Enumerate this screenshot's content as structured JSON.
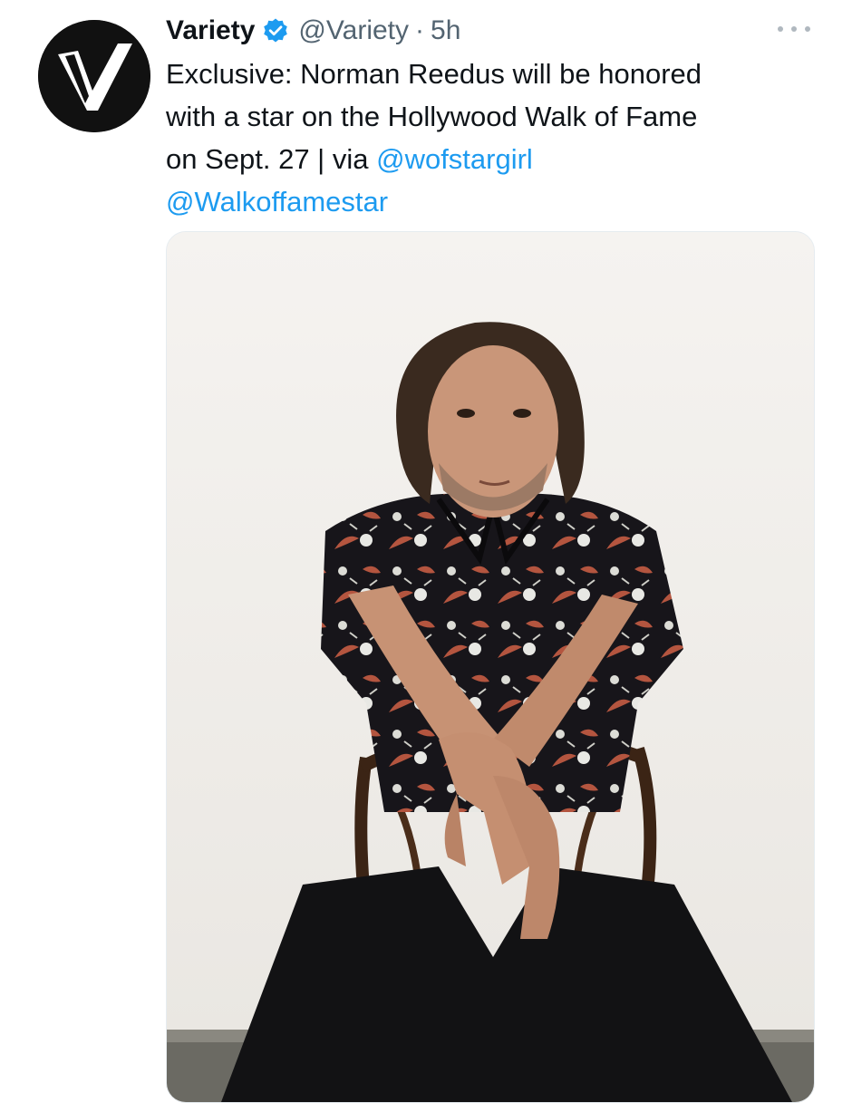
{
  "tweet": {
    "display_name": "Variety",
    "handle": "@Variety",
    "separator": "·",
    "time": "5h",
    "text_line1": "Exclusive: Norman Reedus will be honored",
    "text_line2": "with a star on the Hollywood Walk of Fame",
    "text_line3_prefix": "on Sept. 27 | via ",
    "mention1": "@wofstargirl",
    "mention2": "@Walkoffamestar"
  },
  "icons": {
    "avatar": "variety-logo-icon",
    "verified": "verified-badge-icon",
    "more": "more-options-icon"
  },
  "colors": {
    "link": "#1d9bf0",
    "verified": "#1d9bf0",
    "secondary_text": "#536471",
    "primary_text": "#0f1419"
  }
}
